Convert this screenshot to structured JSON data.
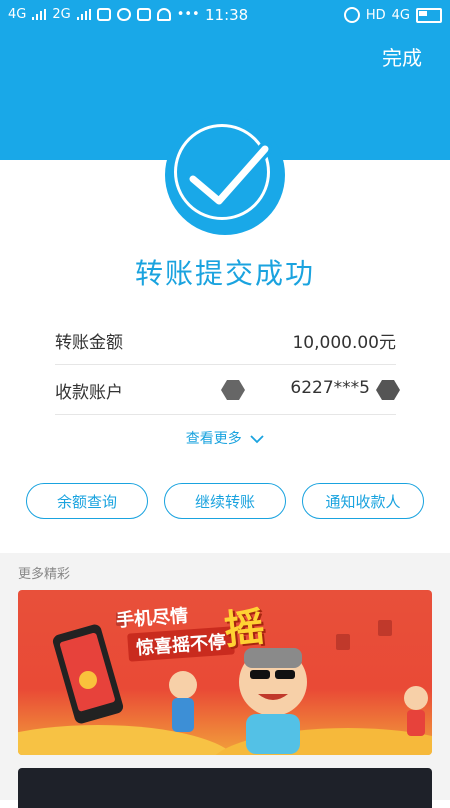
{
  "status_bar": {
    "network1": "4G",
    "network2": "2G",
    "time": "11:38",
    "hd": "HD",
    "network3": "4G"
  },
  "header": {
    "done_label": "完成"
  },
  "result": {
    "title": "转账提交成功"
  },
  "details": {
    "amount_label": "转账金额",
    "amount_value": "10,000.00元",
    "account_label": "收款账户",
    "account_value": "6227***5"
  },
  "more_label": "查看更多",
  "actions": {
    "balance_label": "余额查询",
    "continue_label": "继续转账",
    "notify_label": "通知收款人"
  },
  "section": {
    "title": "更多精彩"
  },
  "banner": {
    "line1": "手机尽情",
    "line2": "惊喜摇不停",
    "highlight": "摇"
  },
  "colors": {
    "brand": "#19a8e8",
    "accent_text": "#1aa3df"
  }
}
